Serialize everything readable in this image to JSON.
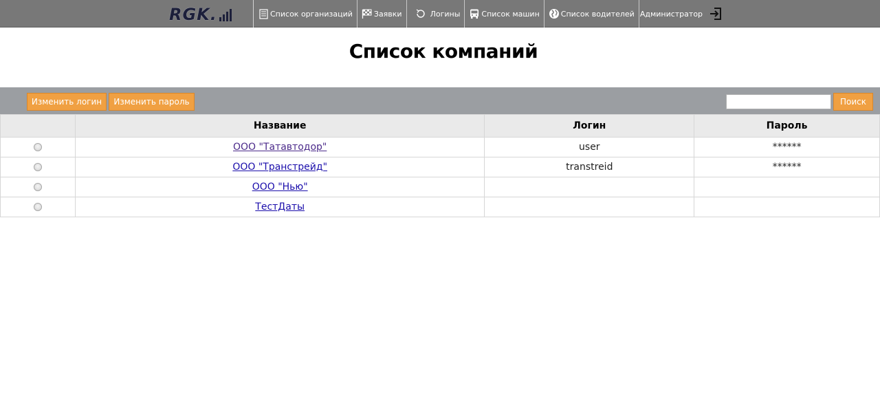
{
  "app": {
    "logo_text": "RGK.",
    "brand_color": "#1c1f3a"
  },
  "nav": {
    "items": [
      {
        "label": "Список организаций",
        "icon": "document-icon"
      },
      {
        "label": "Заявки",
        "icon": "checkered-flag-icon"
      },
      {
        "label": "Логины",
        "icon": "refresh-icon"
      },
      {
        "label": "Список машин",
        "icon": "bus-icon"
      },
      {
        "label": "Список водителей",
        "icon": "globe-icon"
      }
    ],
    "user": "Администратор",
    "logout_icon": "logout-icon"
  },
  "page": {
    "title": "Список компаний"
  },
  "toolbar": {
    "change_login_label": "Изменить логин",
    "change_password_label": "Изменить пароль",
    "search_value": "",
    "search_label": "Поиск",
    "accent_color": "#f0a042"
  },
  "table": {
    "columns": [
      "",
      "Название",
      "Логин",
      "Пароль"
    ],
    "rows": [
      {
        "name": "ООО \"Татавтодор\"",
        "login": "user",
        "password": "******",
        "selected": false
      },
      {
        "name": "ООО \"Транстрейд\"",
        "login": "transtreid",
        "password": "******",
        "selected": false
      },
      {
        "name": "ООО \"Нью\"",
        "login": "",
        "password": "",
        "selected": false
      },
      {
        "name": "ТестДаты",
        "login": "",
        "password": "",
        "selected": false
      }
    ]
  }
}
